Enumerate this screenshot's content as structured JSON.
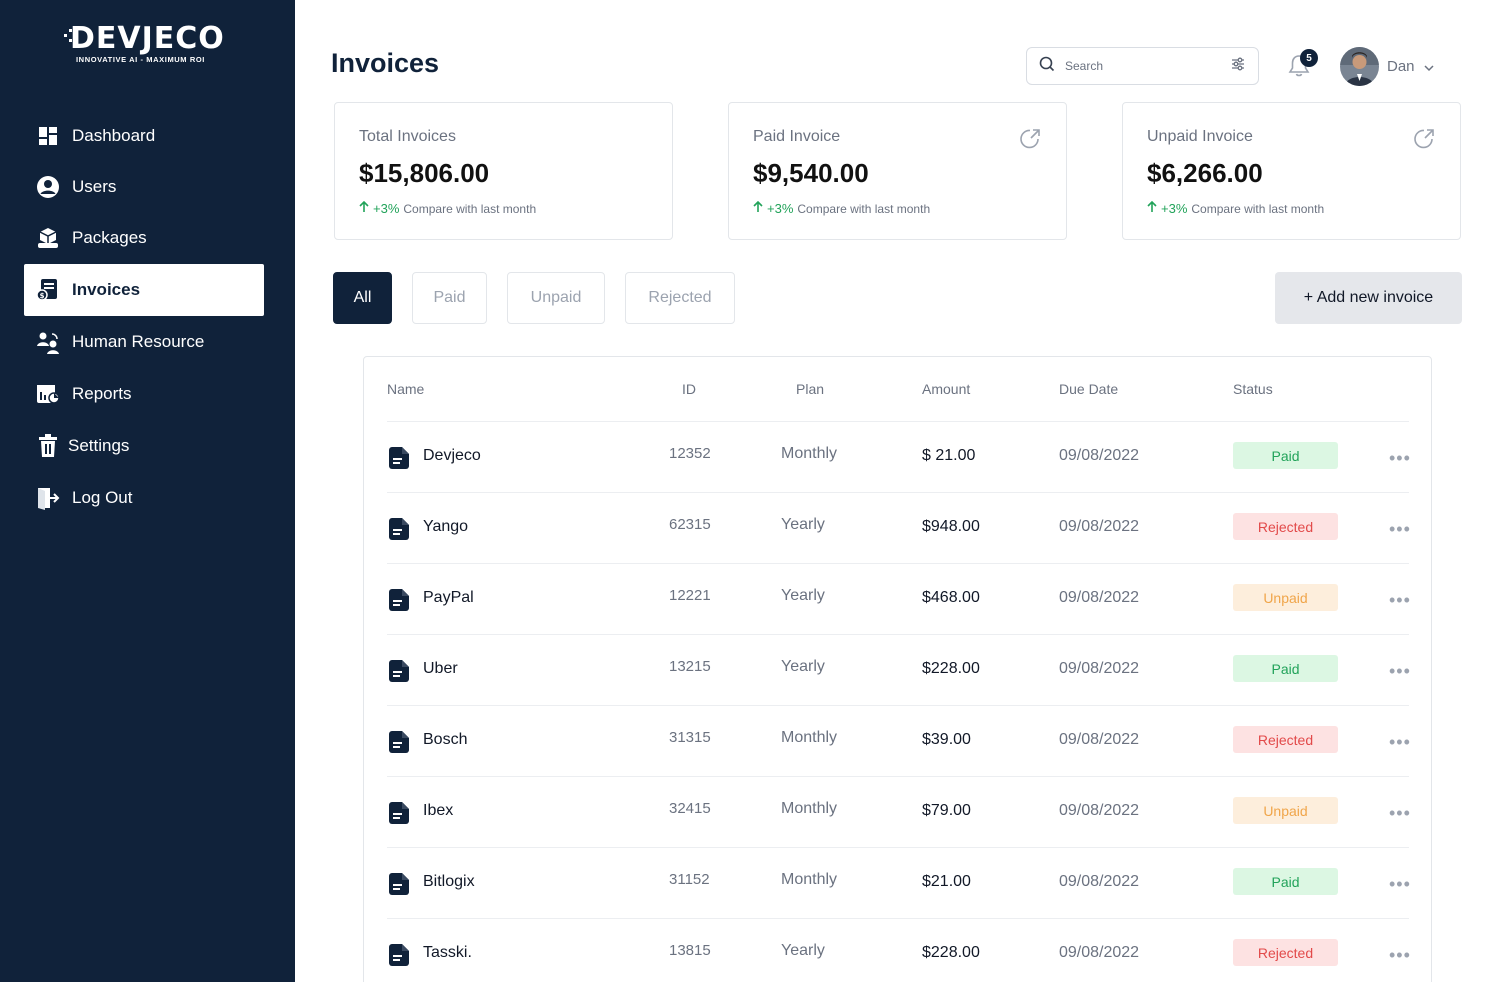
{
  "brand": {
    "name": "DEVJECO",
    "tagline": "INNOVATIVE AI - MAXIMUM ROI"
  },
  "sidebar": {
    "items": [
      {
        "label": "Dashboard",
        "icon": "dashboard-icon"
      },
      {
        "label": "Users",
        "icon": "user-icon"
      },
      {
        "label": "Packages",
        "icon": "package-icon"
      },
      {
        "label": "Invoices",
        "icon": "invoice-icon",
        "active": true
      },
      {
        "label": "Human Resource",
        "icon": "people-icon"
      },
      {
        "label": "Reports",
        "icon": "report-icon"
      },
      {
        "label": "Settings",
        "icon": "settings-icon"
      },
      {
        "label": "Log Out",
        "icon": "logout-icon"
      }
    ]
  },
  "header": {
    "title": "Invoices",
    "search_placeholder": "Search",
    "notification_count": "5",
    "user_name": "Dan"
  },
  "cards": [
    {
      "label": "Total Invoices",
      "value": "$15,806.00",
      "trend": "+3%",
      "compare": "Compare with last month"
    },
    {
      "label": "Paid Invoice",
      "value": "$9,540.00",
      "trend": "+3%",
      "compare": "Compare with last month"
    },
    {
      "label": "Unpaid Invoice",
      "value": "$6,266.00",
      "trend": "+3%",
      "compare": "Compare with last month"
    }
  ],
  "filters": [
    "All",
    "Paid",
    "Unpaid",
    "Rejected"
  ],
  "add_button": "+ Add new invoice",
  "table": {
    "columns": [
      "Name",
      "ID",
      "Plan",
      "Amount",
      "Due Date",
      "Status"
    ],
    "rows": [
      {
        "name": "Devjeco",
        "id": "12352",
        "plan": "Monthly",
        "amount": "$ 21.00",
        "due": "09/08/2022",
        "status": "Paid"
      },
      {
        "name": "Yango",
        "id": "62315",
        "plan": "Yearly",
        "amount": "$948.00",
        "due": "09/08/2022",
        "status": "Rejected"
      },
      {
        "name": "PayPal",
        "id": "12221",
        "plan": "Yearly",
        "amount": "$468.00",
        "due": "09/08/2022",
        "status": "Unpaid"
      },
      {
        "name": "Uber",
        "id": "13215",
        "plan": "Yearly",
        "amount": "$228.00",
        "due": "09/08/2022",
        "status": "Paid"
      },
      {
        "name": "Bosch",
        "id": "31315",
        "plan": "Monthly",
        "amount": "$39.00",
        "due": "09/08/2022",
        "status": "Rejected"
      },
      {
        "name": "Ibex",
        "id": "32415",
        "plan": "Monthly",
        "amount": "$79.00",
        "due": "09/08/2022",
        "status": "Unpaid"
      },
      {
        "name": "Bitlogix",
        "id": "31152",
        "plan": "Monthly",
        "amount": "$21.00",
        "due": "09/08/2022",
        "status": "Paid"
      },
      {
        "name": "Tasski.",
        "id": "13815",
        "plan": "Yearly",
        "amount": "$228.00",
        "due": "09/08/2022",
        "status": "Rejected"
      }
    ]
  },
  "colors": {
    "sidebar": "#10223a",
    "paid": "#22a35a",
    "rejected": "#e24a4a",
    "unpaid": "#f0a54a"
  }
}
